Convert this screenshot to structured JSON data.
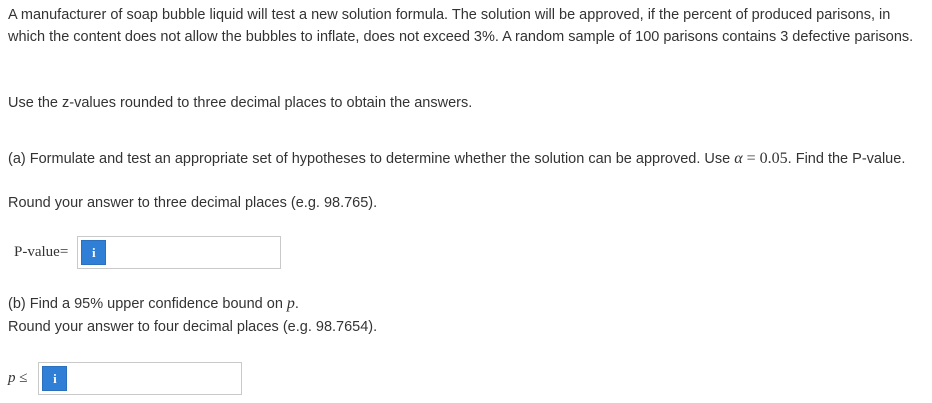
{
  "problem": {
    "intro": "A manufacturer of soap bubble liquid will test a new solution formula. The solution will be approved, if the percent of produced parisons, in which the content does not allow the bubbles to inflate, does not exceed 3%. A random sample of 100 parisons contains 3 defective parisons.",
    "zvalues_note": "Use the z-values rounded to three decimal places to obtain the answers."
  },
  "part_a": {
    "prompt_before": "(a) Formulate and test an appropriate set of hypotheses to determine whether the solution can be approved. Use ",
    "alpha_symbol": "α",
    "alpha_equals": " = 0.05",
    "prompt_after": ". Find the P-value.",
    "rounding": "Round your answer to three decimal places (e.g. 98.765).",
    "answer_label": "P-value=",
    "info_icon_glyph": "i",
    "answer_value": ""
  },
  "part_b": {
    "prompt_before": "(b) Find a 95% upper confidence bound on ",
    "p_symbol": "p",
    "prompt_after": ".",
    "rounding": "Round your answer to four decimal places (e.g. 98.7654).",
    "answer_label": "p ≤",
    "info_icon_glyph": "i",
    "answer_value": ""
  },
  "colors": {
    "info_button": "#2f7fd6",
    "text": "#333333",
    "input_border": "#c9c9c9"
  }
}
